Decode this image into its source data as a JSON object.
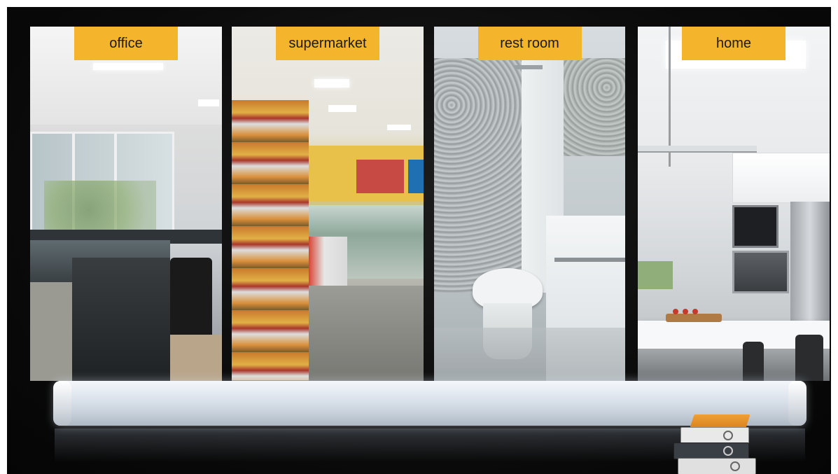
{
  "panels": [
    {
      "label": "office"
    },
    {
      "label": "supermarket"
    },
    {
      "label": "rest room"
    },
    {
      "label": "home"
    }
  ],
  "colors": {
    "label_bg": "#f4b42c",
    "stage_bg": "#0b0b0b"
  }
}
